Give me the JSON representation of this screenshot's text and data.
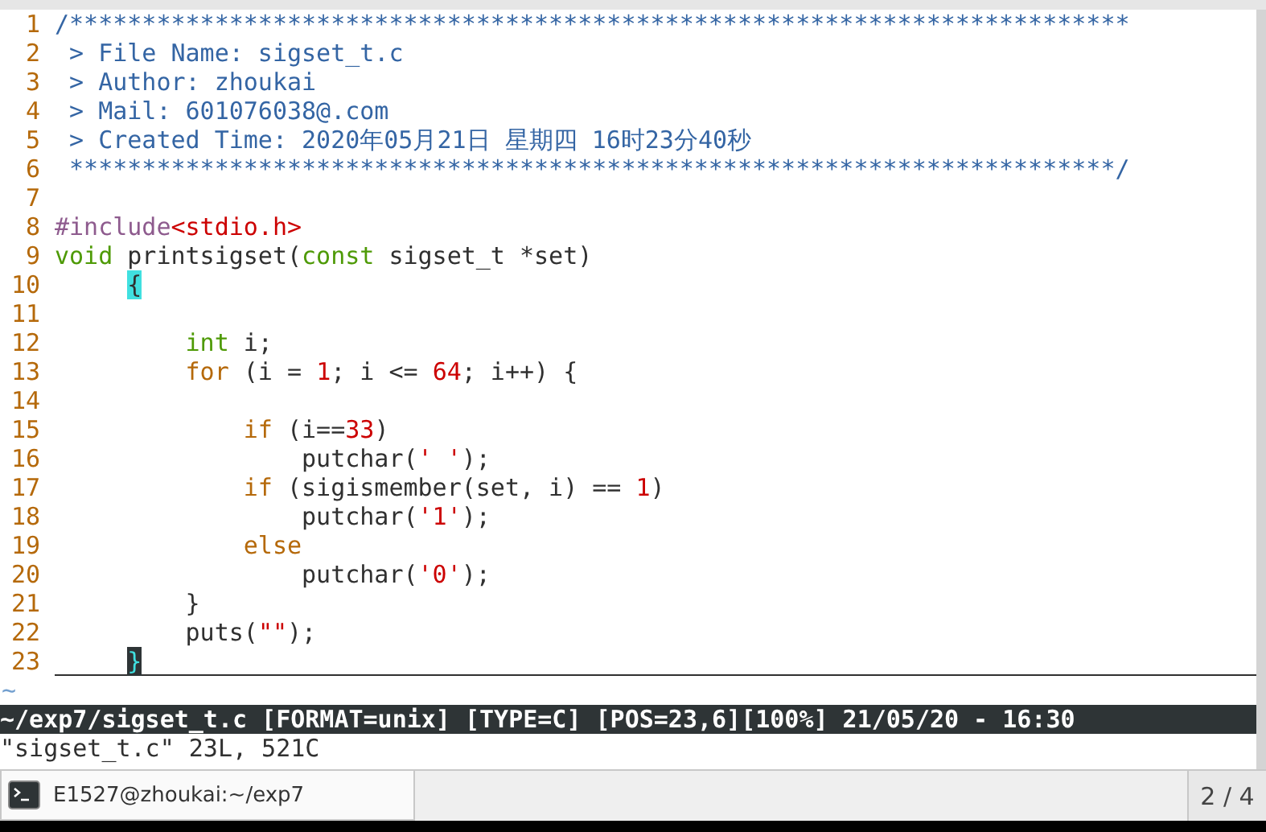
{
  "editor": {
    "lines": [
      {
        "number": "1",
        "current": false,
        "tokens": [
          {
            "kind": "comment",
            "text": "/*************************************************************************"
          }
        ]
      },
      {
        "number": "2",
        "current": false,
        "tokens": [
          {
            "kind": "comment",
            "text": " > File Name: sigset_t.c"
          }
        ]
      },
      {
        "number": "3",
        "current": false,
        "tokens": [
          {
            "kind": "comment",
            "text": " > Author: zhoukai"
          }
        ]
      },
      {
        "number": "4",
        "current": false,
        "tokens": [
          {
            "kind": "comment",
            "text": " > Mail: 601076038@.com"
          }
        ]
      },
      {
        "number": "5",
        "current": false,
        "tokens": [
          {
            "kind": "comment",
            "text": " > Created Time: 2020年05月21日 星期四 16时23分40秒"
          }
        ]
      },
      {
        "number": "6",
        "current": false,
        "tokens": [
          {
            "kind": "comment",
            "text": " ************************************************************************/"
          }
        ]
      },
      {
        "number": "7",
        "current": false
      },
      {
        "number": "8",
        "current": false,
        "tokens": [
          {
            "kind": "preproc",
            "text": "#include"
          },
          {
            "kind": "string",
            "text": "<stdio.h>"
          }
        ]
      },
      {
        "number": "9",
        "current": false,
        "tokens": [
          {
            "kind": "type",
            "text": "void"
          },
          {
            "kind": "plain",
            "text": " printsigset("
          },
          {
            "kind": "type",
            "text": "const"
          },
          {
            "kind": "plain",
            "text": " sigset_t *set)"
          }
        ]
      },
      {
        "number": "10",
        "current": false,
        "tokens": [
          {
            "kind": "match",
            "text": "     {"
          }
        ]
      },
      {
        "number": "11",
        "current": false
      },
      {
        "number": "12",
        "current": false,
        "tokens": [
          {
            "kind": "type",
            "text": "         int"
          },
          {
            "kind": "plain",
            "text": " i;"
          }
        ]
      },
      {
        "number": "13",
        "current": false,
        "tokens": [
          {
            "kind": "keyword",
            "text": "         for"
          },
          {
            "kind": "plain",
            "text": " (i = "
          },
          {
            "kind": "number",
            "text": "1"
          },
          {
            "kind": "plain",
            "text": "; i <= "
          },
          {
            "kind": "number",
            "text": "64"
          },
          {
            "kind": "plain",
            "text": "; i++) {"
          }
        ]
      },
      {
        "number": "14",
        "current": false
      },
      {
        "number": "15",
        "current": false,
        "tokens": [
          {
            "kind": "keyword",
            "text": "             if"
          },
          {
            "kind": "plain",
            "text": " (i=="
          },
          {
            "kind": "number",
            "text": "33"
          },
          {
            "kind": "plain",
            "text": ")"
          }
        ]
      },
      {
        "number": "16",
        "current": false,
        "tokens": [
          {
            "kind": "plain",
            "text": "                 putchar("
          },
          {
            "kind": "string",
            "text": "' '"
          },
          {
            "kind": "plain",
            "text": ");"
          }
        ]
      },
      {
        "number": "17",
        "current": false,
        "tokens": [
          {
            "kind": "keyword",
            "text": "             if"
          },
          {
            "kind": "plain",
            "text": " (sigismember(set, i) == "
          },
          {
            "kind": "number",
            "text": "1"
          },
          {
            "kind": "plain",
            "text": ")"
          }
        ]
      },
      {
        "number": "18",
        "current": false,
        "tokens": [
          {
            "kind": "plain",
            "text": "                 putchar("
          },
          {
            "kind": "string",
            "text": "'1'"
          },
          {
            "kind": "plain",
            "text": ");"
          }
        ]
      },
      {
        "number": "19",
        "current": false,
        "tokens": [
          {
            "kind": "keyword",
            "text": "             else"
          }
        ]
      },
      {
        "number": "20",
        "current": false,
        "tokens": [
          {
            "kind": "plain",
            "text": "                 putchar("
          },
          {
            "kind": "string",
            "text": "'0'"
          },
          {
            "kind": "plain",
            "text": ");"
          }
        ]
      },
      {
        "number": "21",
        "current": false,
        "tokens": [
          {
            "kind": "plain",
            "text": "         }"
          }
        ]
      },
      {
        "number": "22",
        "current": false,
        "tokens": [
          {
            "kind": "plain",
            "text": "         puts("
          },
          {
            "kind": "string",
            "text": "\"\""
          },
          {
            "kind": "plain",
            "text": ");"
          }
        ]
      },
      {
        "number": "23",
        "current": true,
        "tokens": [
          {
            "kind": "cursor",
            "text": "     }"
          }
        ]
      }
    ],
    "filler": "~"
  },
  "status_line": "~/exp7/sigset_t.c [FORMAT=unix] [TYPE=C] [POS=23,6][100%] 21/05/20 - 16:30",
  "message": "\"sigset_t.c\" 23L, 521C",
  "taskbar": {
    "tasks": [
      {
        "label": "E1527@zhoukai:~/exp7",
        "selected": true
      }
    ],
    "workspace": "2 / 4"
  }
}
